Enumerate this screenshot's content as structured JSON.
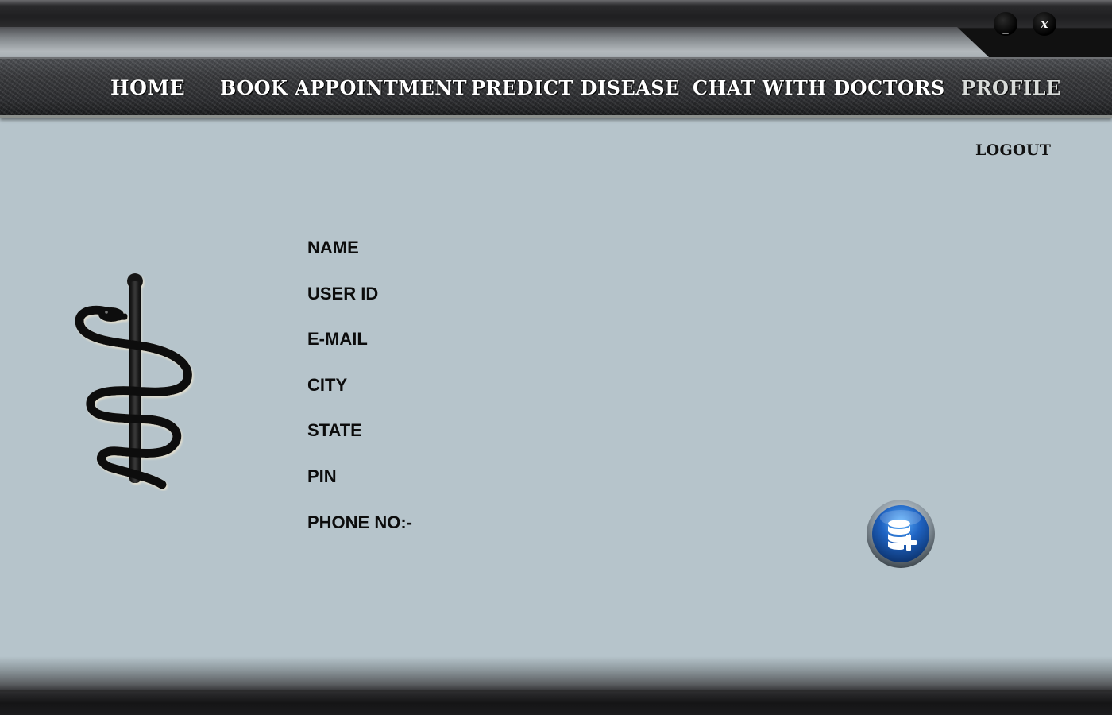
{
  "window": {
    "minimize_label": "_",
    "close_label": "x"
  },
  "nav": {
    "items": [
      {
        "label": "HOME"
      },
      {
        "label": "BOOK APPOINTMENT"
      },
      {
        "label": "PREDICT DISEASE"
      },
      {
        "label": "CHAT WITH DOCTORS"
      },
      {
        "label": "PROFILE"
      }
    ],
    "active": "PROFILE"
  },
  "logout_label": "LOGOUT",
  "emblem_icon": "rod-of-asclepius-icon",
  "profile": {
    "fields": [
      {
        "label": "NAME"
      },
      {
        "label": "USER ID"
      },
      {
        "label": "E-MAIL"
      },
      {
        "label": "CITY"
      },
      {
        "label": "STATE"
      },
      {
        "label": "PIN"
      },
      {
        "label": "PHONE NO:-"
      }
    ]
  },
  "db_button_icon": "database-add-icon",
  "colors": {
    "background": "#b6c4cb",
    "bar_dark": "#2d2e31",
    "button_blue": "#1f63c2"
  }
}
